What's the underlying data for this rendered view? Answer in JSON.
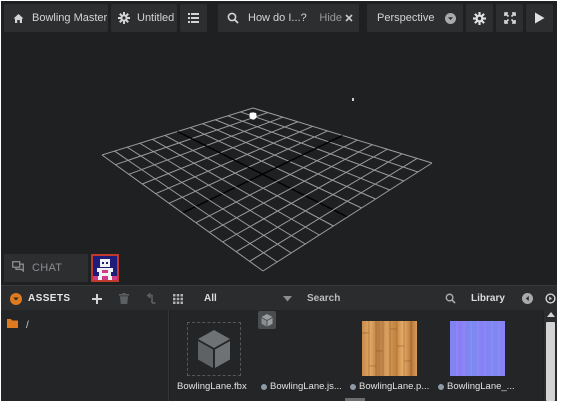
{
  "toolbar": {
    "project_name": "Bowling Master",
    "scene_name": "Untitled",
    "help_placeholder": "How do I...?",
    "help_hide": "Hide",
    "camera_mode": "Perspective"
  },
  "icons": {
    "home": "home-icon",
    "gear": "gear-icon",
    "list": "list-icon",
    "search": "search-icon",
    "close": "close-icon",
    "dropdown": "chevron-down-icon",
    "fullscreen": "fullscreen-icon",
    "play": "play-icon",
    "chat": "chat-icon"
  },
  "chat": {
    "label": "CHAT"
  },
  "assets": {
    "title": "ASSETS",
    "filter_value": "All",
    "search_placeholder": "Search",
    "library_label": "Library",
    "folder_path": "/",
    "files": [
      {
        "name": "BowlingLane.fbx",
        "kind": "model"
      },
      {
        "name": "BowlingLane.js...",
        "kind": "json"
      },
      {
        "name": "BowlingLane.p...",
        "kind": "texture-wood"
      },
      {
        "name": "BowlingLane_...",
        "kind": "texture-normal"
      }
    ]
  },
  "colors": {
    "accent_orange": "#e07a1f",
    "panel_bg": "#2c2e30",
    "viewport_bg": "#1f2021",
    "grid_line": "#9a9c9e",
    "avatar_border": "#c0392b"
  }
}
